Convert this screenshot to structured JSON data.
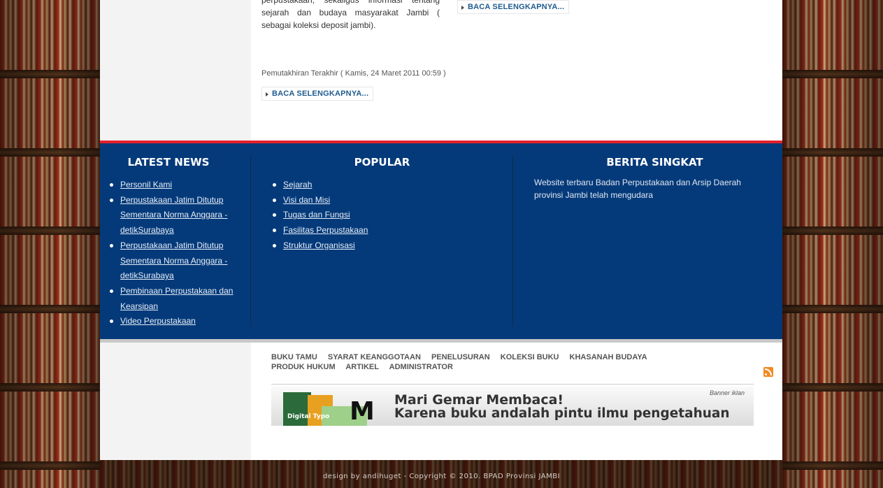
{
  "article": {
    "text": "perpustakaan, sekaligus informasi tentang sejarah dan budaya masyarakat Jambi ( sebagai koleksi deposit jambi).",
    "meta": "Pemutakhiran Terakhir ( Kamis, 24 Maret 2011 00:59 )",
    "read_more": "BACA SELENGKAPNYA...",
    "read_more_top": "BACA SELENGKAPNYA..."
  },
  "footer": {
    "latest_news": {
      "title": "LATEST NEWS",
      "items": [
        "Personil Kami",
        "Perpustakaan Jatim Ditutup Sementara Norma Anggara - detikSurabaya",
        "Perpustakaan Jatim Ditutup Sementara Norma Anggara - detikSurabaya",
        "Pembinaan Perpustakaan dan Kearsipan",
        "Video Perpustakaan"
      ]
    },
    "popular": {
      "title": "POPULAR",
      "items": [
        "Sejarah",
        "Visi dan Misi",
        "Tugas dan Fungsi",
        "Fasilitas Perpustakaan",
        "Struktur Organisasi"
      ]
    },
    "berita": {
      "title": "BERITA SINGKAT",
      "text": "Website terbaru Badan Perpustakaan dan Arsip Daerah provinsi Jambi telah mengudara"
    }
  },
  "bottom_nav": [
    "BUKU TAMU",
    "SYARAT KEANGGOTAAN",
    "PENELUSURAN",
    "KOLEKSI BUKU",
    "KHASANAH BUDAYA",
    "PRODUK HUKUM",
    "ARTIKEL",
    "ADMINISTRATOR"
  ],
  "banner": {
    "label": "Banner iklan",
    "slogan1": "Mari Gemar Membaca!",
    "slogan2": "Karena buku andalah pintu ilmu pengetahuan",
    "book_text": "Digital Typo",
    "book_letter": "M"
  },
  "copyright": "design by andihuget - Copyright © 2010. BPAD Provinsi JAMBI",
  "colors": {
    "footer_bg": "#053a7a",
    "accent_red": "#e4202a",
    "link_blue": "#1f5b8e"
  }
}
